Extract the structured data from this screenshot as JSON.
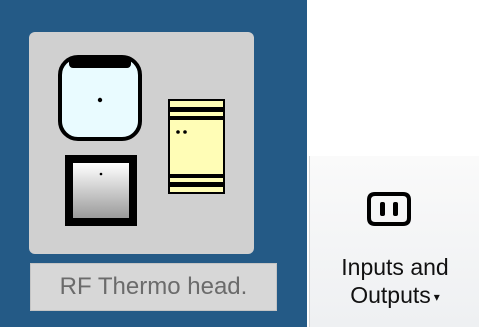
{
  "device_tile": {
    "caption": "RF Thermo head.",
    "selected": true,
    "icons": [
      "thermostat-icon",
      "thermo-head-icon",
      "din-rail-module-icon"
    ]
  },
  "ribbon": {
    "inputs_outputs": {
      "line1": "Inputs and",
      "line2": "Outputs",
      "dropdown_caret": "▾",
      "icon": "power-socket-icon"
    }
  }
}
